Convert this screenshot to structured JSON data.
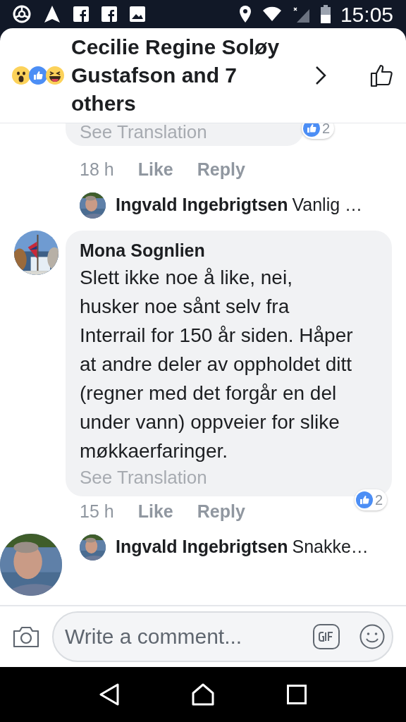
{
  "status_bar": {
    "time": "15:05"
  },
  "header": {
    "title": "Cecilie Regine Soløy Gustafson and 7 others"
  },
  "comments": [
    {
      "kind": "partial",
      "see_translation": "See Translation",
      "reaction_count": "2",
      "time": "18 h",
      "like": "Like",
      "reply": "Reply",
      "reply_preview": {
        "author": "Ingvald Ingebrigtsen",
        "text": "Vanlig …"
      }
    },
    {
      "kind": "full",
      "author": "Mona Sognlien",
      "text": "Slett ikke noe å like, nei, husker noe sånt selv fra Interrail for 150 år siden. Håper at andre deler av oppholdet ditt (regner med det forgår en del under vann) oppveier for slike møkkaerfaringer.",
      "see_translation": "See Translation",
      "reaction_count": "2",
      "time": "15 h",
      "like": "Like",
      "reply": "Reply",
      "reply_preview": {
        "author": "Ingvald Ingebrigtsen",
        "text": "Snakke…"
      }
    }
  ],
  "composer": {
    "placeholder": "Write a comment..."
  }
}
